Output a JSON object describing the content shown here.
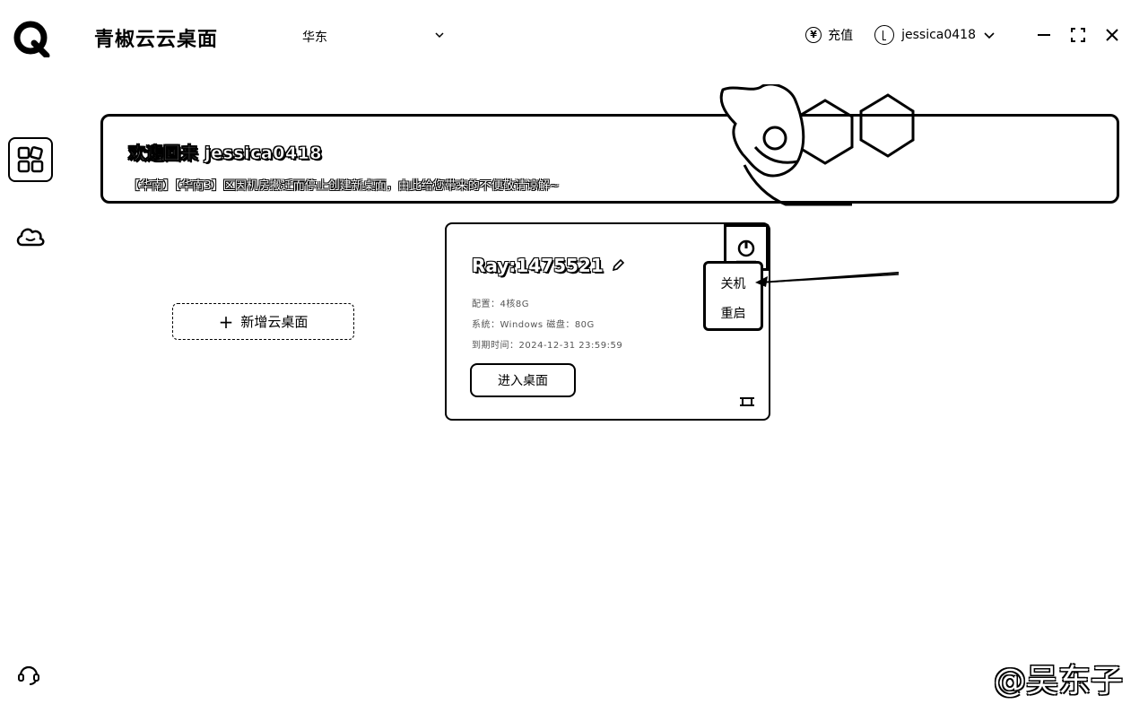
{
  "app": {
    "title": "青椒云云桌面"
  },
  "header": {
    "region": "华东",
    "recharge_label": "充值",
    "username": "jessica0418"
  },
  "banner": {
    "title": "欢迎回来 jessica0418",
    "notice": "【华南】【华南3】区因机房搬迁而停止创建新桌面，由此给您带来的不便敬请谅解~"
  },
  "main": {
    "add_desktop_label": "新增云桌面"
  },
  "desktop_card": {
    "name": "Ray:1475521",
    "info_lines": [
      "配置：4核8G",
      "系统：Windows  磁盘：80G",
      "到期时间：2024-12-31 23:59:59"
    ],
    "enter_label": "进入桌面",
    "power_menu": {
      "shutdown": "关机",
      "restart": "重启"
    }
  },
  "watermark": "@吴东子"
}
